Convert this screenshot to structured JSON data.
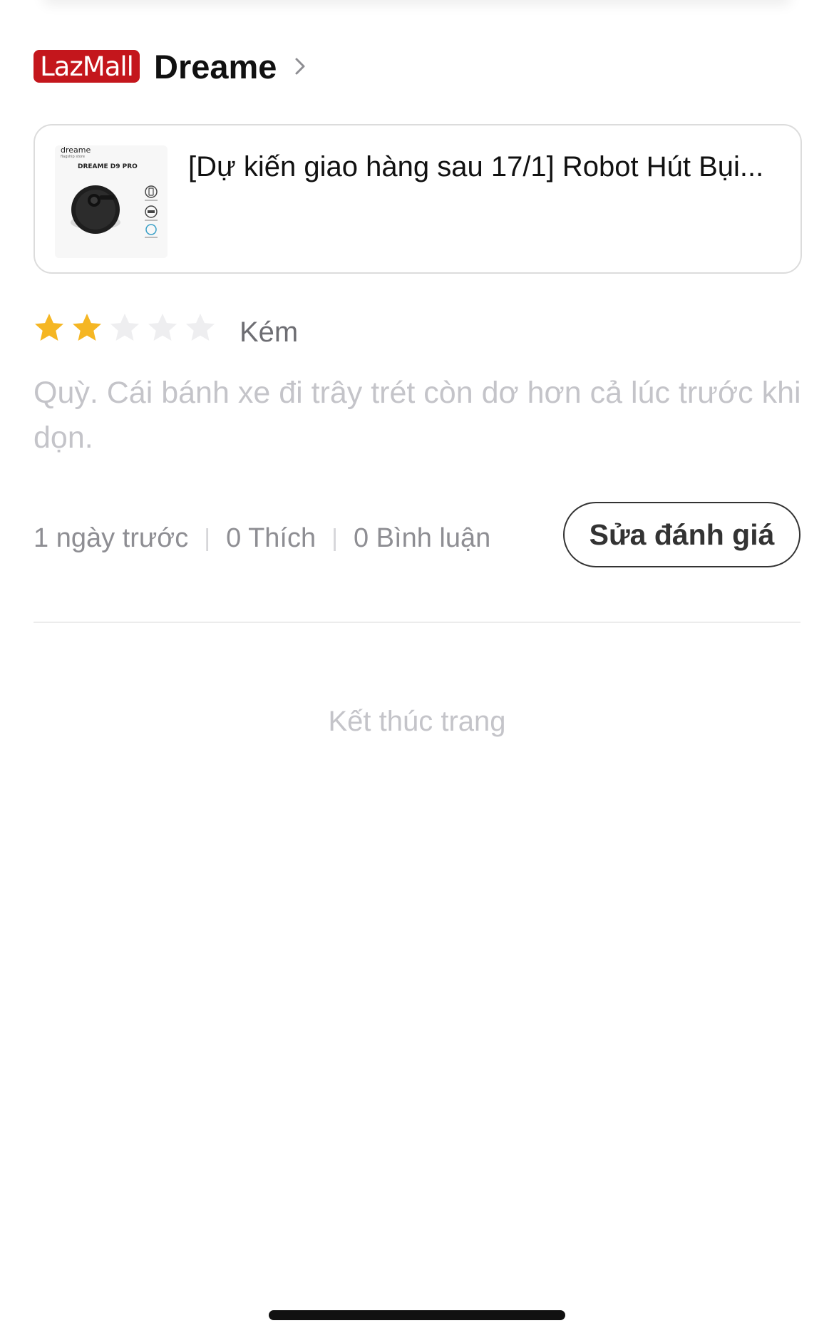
{
  "store": {
    "badge": "LazMall",
    "name": "Dreame"
  },
  "product": {
    "title": "[Dự kiến giao hàng sau 17/1] Robot Hút Bụi...",
    "thumbnail": {
      "brand": "dreame",
      "brand_sub": "flagship store",
      "model": "DREAME D9 PRO"
    }
  },
  "rating": {
    "stars": 2,
    "max_stars": 5,
    "label": "Kém",
    "filled_color": "#f5b623",
    "empty_color": "#eeeef0"
  },
  "review": {
    "text": "Quỳ. Cái bánh xe đi trây trét còn dơ hơn cả lúc trước khi dọn."
  },
  "meta": {
    "time": "1 ngày trước",
    "separator": "|",
    "likes": "0 Thích",
    "comments": "0 Bình luận"
  },
  "actions": {
    "edit_review": "Sửa đánh giá"
  },
  "footer": {
    "end_of_page": "Kết thúc trang"
  }
}
